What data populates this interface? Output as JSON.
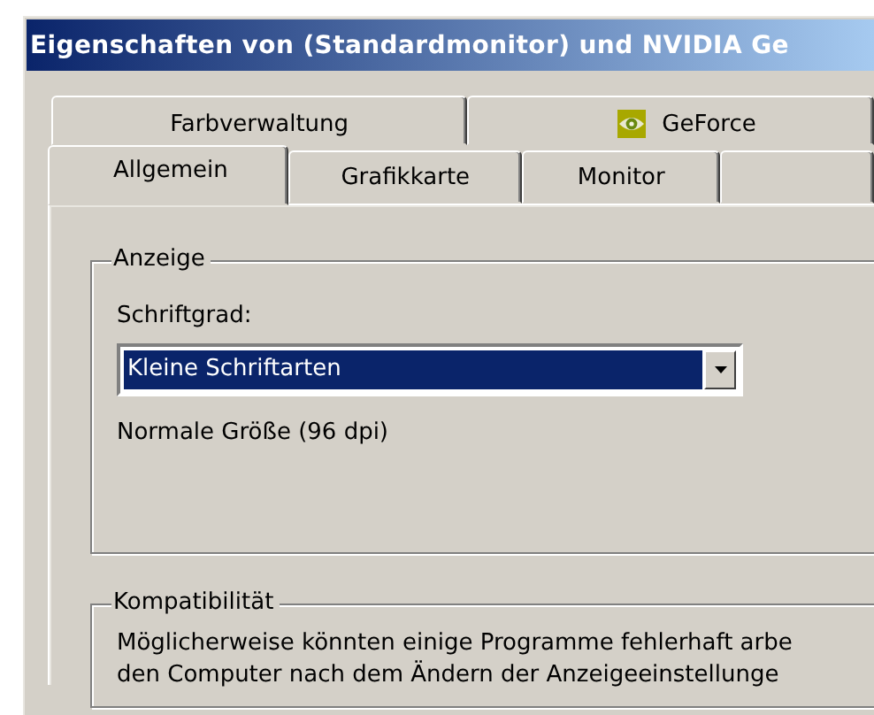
{
  "window": {
    "title": "Eigenschaften von (Standardmonitor) und NVIDIA Ge"
  },
  "tab_rows": [
    {
      "tabs": [
        {
          "label": "Farbverwaltung",
          "kind": "text",
          "selected": false
        },
        {
          "label": "GeForce",
          "kind": "icon",
          "selected": false
        }
      ]
    },
    {
      "tabs": [
        {
          "label": "Allgemein",
          "selected": true
        },
        {
          "label": "Grafikkarte",
          "selected": false
        },
        {
          "label": "Monitor",
          "selected": false
        },
        {
          "selected": false
        }
      ]
    }
  ],
  "groups": [
    {
      "title": "Anzeige",
      "items": [
        {
          "kind": "label",
          "text": "Schriftgrad:"
        },
        {
          "kind": "dropdown",
          "value": "Kleine Schriftarten",
          "highlighted": true
        },
        {
          "kind": "label",
          "text": "Normale Größe (96 dpi)"
        }
      ]
    },
    {
      "title": "Kompatibilität",
      "items": [
        {
          "kind": "paragraph",
          "lines": [
            "Möglicherweise könnten einige Programme fehlerhaft arbe",
            "den Computer nach dem Ändern der Anzeigeeinstellunge"
          ]
        }
      ]
    }
  ]
}
